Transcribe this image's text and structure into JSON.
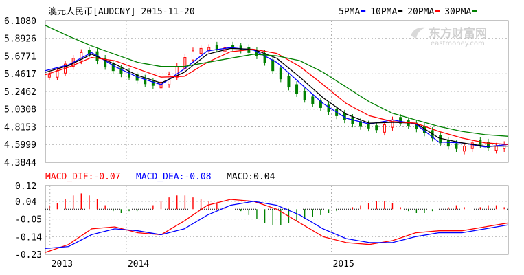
{
  "header": {
    "title": "澳元人民币[AUDCNY] 2015-11-20",
    "legend": [
      {
        "label": "5PMA",
        "color": "#0000ff"
      },
      {
        "label": "10PMA",
        "color": "#000000"
      },
      {
        "label": "20PMA",
        "color": "#ff0000"
      },
      {
        "label": "30PMA",
        "color": "#008000"
      }
    ]
  },
  "watermark": {
    "cn": "东方财富网",
    "en": "eastmoney.com"
  },
  "macd_header": {
    "dif": "MACD_DIF:-0.07",
    "dea": "MACD_DEA:-0.08",
    "macd": "MACD:0.04"
  },
  "colors": {
    "up": "#ff0000",
    "down": "#008000",
    "dif": "#ff0000",
    "dea": "#0000ff",
    "ma5": "#0000ff",
    "ma10": "#000000",
    "ma20": "#ff0000",
    "ma30": "#008000"
  },
  "chart_data": [
    {
      "type": "candlestick",
      "title": "澳元人民币[AUDCNY] 2015-11-20",
      "yticks": [
        "6.1080",
        "5.8926",
        "5.6771",
        "5.4617",
        "5.2462",
        "5.0308",
        "4.8153",
        "4.5999",
        "4.3844"
      ],
      "ylim": [
        4.3844,
        6.108
      ],
      "xticks": [
        {
          "label": "2014",
          "pos": 0.175
        },
        {
          "label": "2015",
          "pos": 0.618
        }
      ],
      "series": [
        {
          "name": "5PMA",
          "x": [
            0,
            0.05,
            0.1,
            0.15,
            0.2,
            0.25,
            0.3,
            0.35,
            0.4,
            0.45,
            0.5,
            0.55,
            0.6,
            0.65,
            0.7,
            0.75,
            0.8,
            0.85,
            0.9,
            0.95,
            1.0
          ],
          "values": [
            5.5,
            5.57,
            5.72,
            5.55,
            5.42,
            5.33,
            5.52,
            5.74,
            5.78,
            5.75,
            5.6,
            5.35,
            5.1,
            4.92,
            4.85,
            4.9,
            4.85,
            4.63,
            4.62,
            4.57,
            4.6
          ]
        },
        {
          "name": "10PMA",
          "x": [
            0,
            0.05,
            0.1,
            0.15,
            0.2,
            0.25,
            0.3,
            0.35,
            0.4,
            0.45,
            0.5,
            0.55,
            0.6,
            0.65,
            0.7,
            0.75,
            0.8,
            0.85,
            0.9,
            0.95,
            1.0
          ],
          "values": [
            5.48,
            5.56,
            5.7,
            5.58,
            5.44,
            5.35,
            5.48,
            5.7,
            5.77,
            5.76,
            5.65,
            5.42,
            5.17,
            4.97,
            4.86,
            4.87,
            4.86,
            4.68,
            4.62,
            4.58,
            4.58
          ]
        },
        {
          "name": "20PMA",
          "x": [
            0,
            0.05,
            0.1,
            0.15,
            0.2,
            0.25,
            0.3,
            0.35,
            0.4,
            0.45,
            0.5,
            0.55,
            0.6,
            0.65,
            0.7,
            0.75,
            0.8,
            0.85,
            0.9,
            0.95,
            1.0
          ],
          "values": [
            5.45,
            5.54,
            5.66,
            5.62,
            5.52,
            5.42,
            5.43,
            5.6,
            5.73,
            5.76,
            5.71,
            5.55,
            5.33,
            5.1,
            4.95,
            4.88,
            4.86,
            4.76,
            4.68,
            4.62,
            4.6
          ]
        },
        {
          "name": "30PMA",
          "x": [
            0,
            0.05,
            0.1,
            0.15,
            0.2,
            0.25,
            0.3,
            0.35,
            0.4,
            0.45,
            0.5,
            0.55,
            0.6,
            0.65,
            0.7,
            0.75,
            0.8,
            0.85,
            0.9,
            0.95,
            1.0
          ],
          "values": [
            6.05,
            5.92,
            5.8,
            5.7,
            5.6,
            5.55,
            5.55,
            5.6,
            5.65,
            5.7,
            5.68,
            5.62,
            5.48,
            5.3,
            5.12,
            4.98,
            4.9,
            4.82,
            4.76,
            4.72,
            4.7
          ]
        }
      ],
      "candles_close": [
        5.45,
        5.5,
        5.58,
        5.65,
        5.72,
        5.7,
        5.62,
        5.55,
        5.5,
        5.46,
        5.42,
        5.38,
        5.34,
        5.32,
        5.36,
        5.45,
        5.55,
        5.66,
        5.74,
        5.77,
        5.78,
        5.76,
        5.78,
        5.77,
        5.75,
        5.72,
        5.68,
        5.6,
        5.5,
        5.4,
        5.3,
        5.22,
        5.15,
        5.1,
        5.05,
        5.0,
        4.95,
        4.9,
        4.85,
        4.82,
        4.8,
        4.78,
        4.84,
        4.9,
        4.86,
        4.83,
        4.79,
        4.74,
        4.68,
        4.62,
        4.58,
        4.55,
        4.58,
        4.62,
        4.6,
        4.56,
        4.58,
        4.6
      ],
      "candles_up": [
        1,
        1,
        1,
        1,
        1,
        0,
        0,
        0,
        0,
        0,
        0,
        0,
        0,
        0,
        1,
        1,
        1,
        1,
        1,
        1,
        1,
        0,
        1,
        0,
        0,
        0,
        0,
        0,
        0,
        0,
        0,
        0,
        0,
        0,
        0,
        0,
        0,
        0,
        0,
        0,
        0,
        0,
        1,
        1,
        0,
        0,
        0,
        0,
        0,
        0,
        0,
        0,
        1,
        1,
        0,
        0,
        1,
        1
      ]
    },
    {
      "type": "macd",
      "yticks": [
        "0.12",
        "0.04",
        "-0.05",
        "-0.14",
        "-0.23"
      ],
      "ylim": [
        -0.23,
        0.12
      ],
      "xticks": [
        {
          "label": "2013",
          "pos": 0.01
        },
        {
          "label": "2014",
          "pos": 0.175
        },
        {
          "label": "2015",
          "pos": 0.618
        }
      ],
      "series": [
        {
          "name": "MACD_DIF",
          "x": [
            0,
            0.05,
            0.1,
            0.15,
            0.2,
            0.25,
            0.3,
            0.35,
            0.4,
            0.45,
            0.5,
            0.55,
            0.6,
            0.65,
            0.7,
            0.75,
            0.8,
            0.85,
            0.9,
            0.95,
            1.0
          ],
          "values": [
            -0.22,
            -0.18,
            -0.1,
            -0.09,
            -0.12,
            -0.13,
            -0.06,
            0.02,
            0.05,
            0.04,
            0.0,
            -0.07,
            -0.14,
            -0.17,
            -0.18,
            -0.16,
            -0.12,
            -0.11,
            -0.11,
            -0.09,
            -0.07
          ]
        },
        {
          "name": "MACD_DEA",
          "x": [
            0,
            0.05,
            0.1,
            0.15,
            0.2,
            0.25,
            0.3,
            0.35,
            0.4,
            0.45,
            0.5,
            0.55,
            0.6,
            0.65,
            0.7,
            0.75,
            0.8,
            0.85,
            0.9,
            0.95,
            1.0
          ],
          "values": [
            -0.2,
            -0.19,
            -0.13,
            -0.1,
            -0.11,
            -0.13,
            -0.1,
            -0.03,
            0.02,
            0.04,
            0.02,
            -0.03,
            -0.1,
            -0.15,
            -0.17,
            -0.17,
            -0.14,
            -0.12,
            -0.12,
            -0.1,
            -0.08
          ]
        }
      ],
      "bars": [
        0.02,
        0.03,
        0.05,
        0.07,
        0.08,
        0.07,
        0.05,
        0.02,
        -0.01,
        -0.02,
        -0.01,
        -0.01,
        0.0,
        0.02,
        0.04,
        0.06,
        0.07,
        0.07,
        0.06,
        0.05,
        0.04,
        0.03,
        0.01,
        0.0,
        -0.01,
        -0.03,
        -0.05,
        -0.07,
        -0.08,
        -0.08,
        -0.07,
        -0.06,
        -0.05,
        -0.04,
        -0.03,
        -0.02,
        -0.01,
        0.0,
        0.01,
        0.02,
        0.03,
        0.04,
        0.04,
        0.03,
        0.01,
        -0.01,
        -0.02,
        -0.02,
        -0.01,
        0.0,
        0.01,
        0.02,
        0.01,
        0.0,
        0.01,
        0.02,
        0.02,
        0.01
      ]
    }
  ]
}
